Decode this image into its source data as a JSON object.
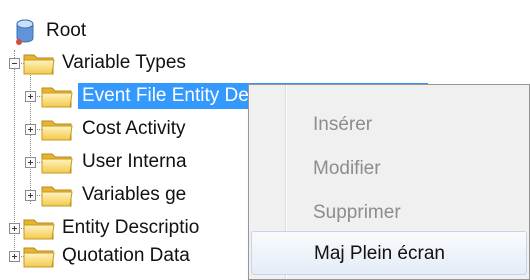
{
  "tree": {
    "root": {
      "label": "Root",
      "icon": "database-icon"
    },
    "nodes": [
      {
        "label": "Variable Types",
        "icon": "folder-icon",
        "expanded": true,
        "level": 1
      },
      {
        "label": "Event File Entity Description (Updatable)",
        "icon": "folder-icon",
        "expanded": false,
        "level": 2,
        "selected": true
      },
      {
        "label": "Cost Activity",
        "icon": "folder-icon",
        "expanded": false,
        "level": 2
      },
      {
        "label": "User Interna",
        "icon": "folder-icon",
        "expanded": false,
        "level": 2
      },
      {
        "label": "Variables ge",
        "icon": "folder-icon",
        "expanded": false,
        "level": 2
      },
      {
        "label": "Entity Descriptio",
        "icon": "folder-icon",
        "expanded": false,
        "level": 1
      },
      {
        "label": "Quotation Data",
        "icon": "folder-icon",
        "expanded": false,
        "level": 1
      }
    ]
  },
  "context_menu": {
    "items": [
      {
        "label": "Insérer",
        "enabled": false
      },
      {
        "label": "Modifier",
        "enabled": false
      },
      {
        "label": "Supprimer",
        "enabled": false
      },
      {
        "label": "Maj Plein écran",
        "enabled": true,
        "highlighted": true
      }
    ]
  },
  "colors": {
    "selection": "#3399ff",
    "folder": "#f2c94c",
    "menu_background": "#f0f0f0",
    "disabled_text": "#8d8d8d"
  }
}
